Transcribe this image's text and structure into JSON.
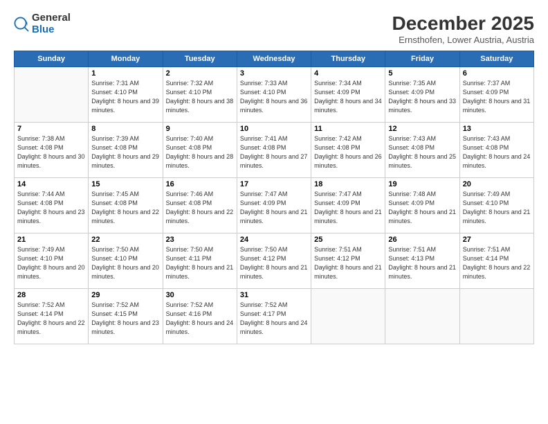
{
  "logo": {
    "general": "General",
    "blue": "Blue"
  },
  "title": "December 2025",
  "location": "Ernsthofen, Lower Austria, Austria",
  "days_of_week": [
    "Sunday",
    "Monday",
    "Tuesday",
    "Wednesday",
    "Thursday",
    "Friday",
    "Saturday"
  ],
  "weeks": [
    [
      {
        "day": "",
        "sunrise": "",
        "sunset": "",
        "daylight": ""
      },
      {
        "day": "1",
        "sunrise": "7:31 AM",
        "sunset": "4:10 PM",
        "daylight": "8 hours and 39 minutes."
      },
      {
        "day": "2",
        "sunrise": "7:32 AM",
        "sunset": "4:10 PM",
        "daylight": "8 hours and 38 minutes."
      },
      {
        "day": "3",
        "sunrise": "7:33 AM",
        "sunset": "4:10 PM",
        "daylight": "8 hours and 36 minutes."
      },
      {
        "day": "4",
        "sunrise": "7:34 AM",
        "sunset": "4:09 PM",
        "daylight": "8 hours and 34 minutes."
      },
      {
        "day": "5",
        "sunrise": "7:35 AM",
        "sunset": "4:09 PM",
        "daylight": "8 hours and 33 minutes."
      },
      {
        "day": "6",
        "sunrise": "7:37 AM",
        "sunset": "4:09 PM",
        "daylight": "8 hours and 31 minutes."
      }
    ],
    [
      {
        "day": "7",
        "sunrise": "7:38 AM",
        "sunset": "4:08 PM",
        "daylight": "8 hours and 30 minutes."
      },
      {
        "day": "8",
        "sunrise": "7:39 AM",
        "sunset": "4:08 PM",
        "daylight": "8 hours and 29 minutes."
      },
      {
        "day": "9",
        "sunrise": "7:40 AM",
        "sunset": "4:08 PM",
        "daylight": "8 hours and 28 minutes."
      },
      {
        "day": "10",
        "sunrise": "7:41 AM",
        "sunset": "4:08 PM",
        "daylight": "8 hours and 27 minutes."
      },
      {
        "day": "11",
        "sunrise": "7:42 AM",
        "sunset": "4:08 PM",
        "daylight": "8 hours and 26 minutes."
      },
      {
        "day": "12",
        "sunrise": "7:43 AM",
        "sunset": "4:08 PM",
        "daylight": "8 hours and 25 minutes."
      },
      {
        "day": "13",
        "sunrise": "7:43 AM",
        "sunset": "4:08 PM",
        "daylight": "8 hours and 24 minutes."
      }
    ],
    [
      {
        "day": "14",
        "sunrise": "7:44 AM",
        "sunset": "4:08 PM",
        "daylight": "8 hours and 23 minutes."
      },
      {
        "day": "15",
        "sunrise": "7:45 AM",
        "sunset": "4:08 PM",
        "daylight": "8 hours and 22 minutes."
      },
      {
        "day": "16",
        "sunrise": "7:46 AM",
        "sunset": "4:08 PM",
        "daylight": "8 hours and 22 minutes."
      },
      {
        "day": "17",
        "sunrise": "7:47 AM",
        "sunset": "4:09 PM",
        "daylight": "8 hours and 21 minutes."
      },
      {
        "day": "18",
        "sunrise": "7:47 AM",
        "sunset": "4:09 PM",
        "daylight": "8 hours and 21 minutes."
      },
      {
        "day": "19",
        "sunrise": "7:48 AM",
        "sunset": "4:09 PM",
        "daylight": "8 hours and 21 minutes."
      },
      {
        "day": "20",
        "sunrise": "7:49 AM",
        "sunset": "4:10 PM",
        "daylight": "8 hours and 21 minutes."
      }
    ],
    [
      {
        "day": "21",
        "sunrise": "7:49 AM",
        "sunset": "4:10 PM",
        "daylight": "8 hours and 20 minutes."
      },
      {
        "day": "22",
        "sunrise": "7:50 AM",
        "sunset": "4:10 PM",
        "daylight": "8 hours and 20 minutes."
      },
      {
        "day": "23",
        "sunrise": "7:50 AM",
        "sunset": "4:11 PM",
        "daylight": "8 hours and 21 minutes."
      },
      {
        "day": "24",
        "sunrise": "7:50 AM",
        "sunset": "4:12 PM",
        "daylight": "8 hours and 21 minutes."
      },
      {
        "day": "25",
        "sunrise": "7:51 AM",
        "sunset": "4:12 PM",
        "daylight": "8 hours and 21 minutes."
      },
      {
        "day": "26",
        "sunrise": "7:51 AM",
        "sunset": "4:13 PM",
        "daylight": "8 hours and 21 minutes."
      },
      {
        "day": "27",
        "sunrise": "7:51 AM",
        "sunset": "4:14 PM",
        "daylight": "8 hours and 22 minutes."
      }
    ],
    [
      {
        "day": "28",
        "sunrise": "7:52 AM",
        "sunset": "4:14 PM",
        "daylight": "8 hours and 22 minutes."
      },
      {
        "day": "29",
        "sunrise": "7:52 AM",
        "sunset": "4:15 PM",
        "daylight": "8 hours and 23 minutes."
      },
      {
        "day": "30",
        "sunrise": "7:52 AM",
        "sunset": "4:16 PM",
        "daylight": "8 hours and 24 minutes."
      },
      {
        "day": "31",
        "sunrise": "7:52 AM",
        "sunset": "4:17 PM",
        "daylight": "8 hours and 24 minutes."
      },
      {
        "day": "",
        "sunrise": "",
        "sunset": "",
        "daylight": ""
      },
      {
        "day": "",
        "sunrise": "",
        "sunset": "",
        "daylight": ""
      },
      {
        "day": "",
        "sunrise": "",
        "sunset": "",
        "daylight": ""
      }
    ]
  ]
}
